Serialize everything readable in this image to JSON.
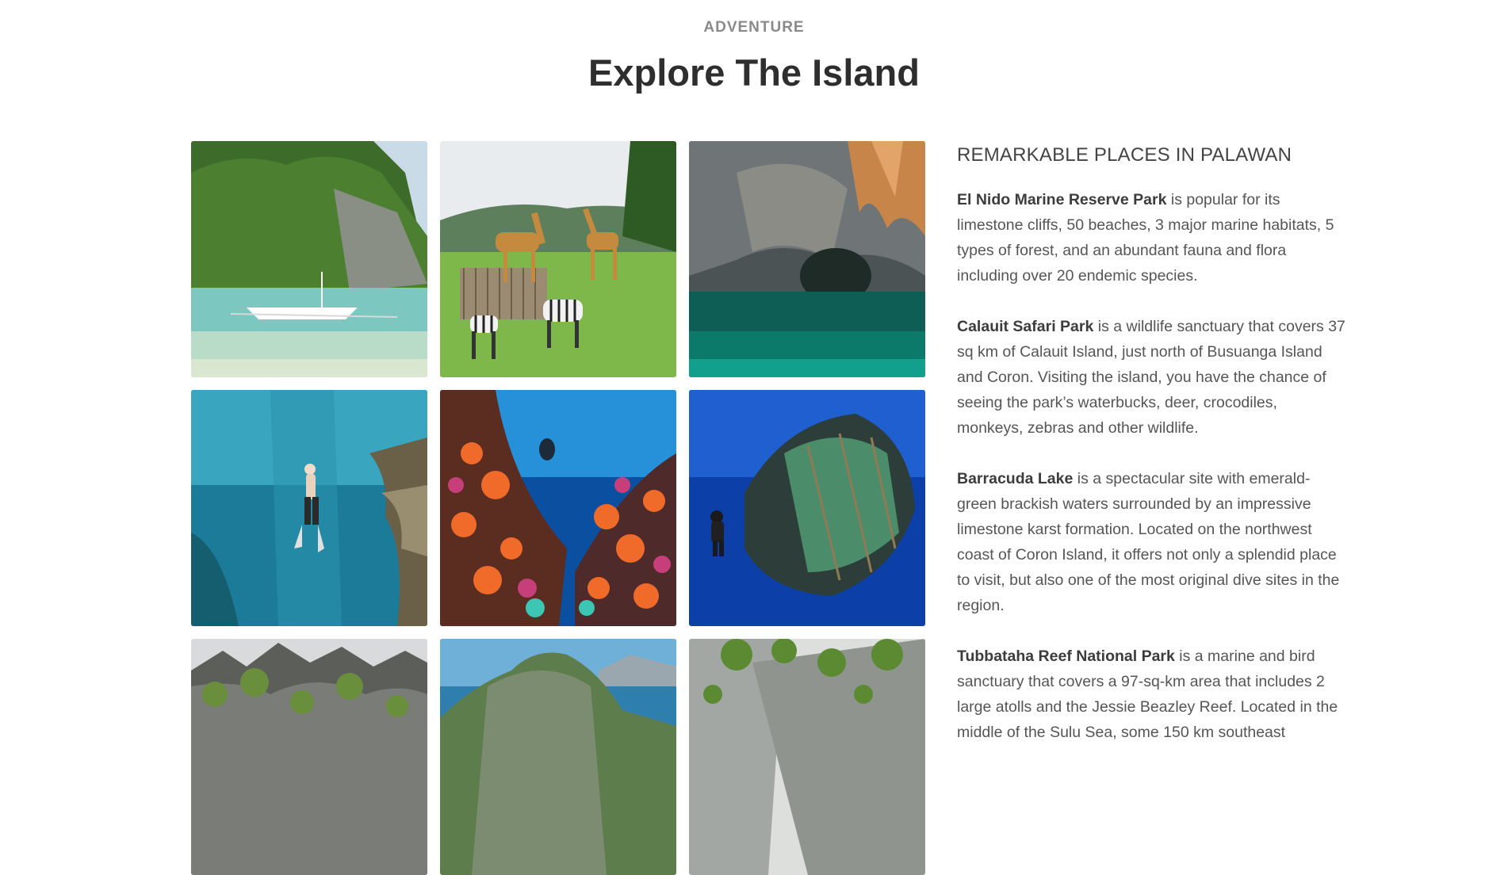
{
  "section": {
    "eyebrow": "ADVENTURE",
    "title": "Explore The Island"
  },
  "gallery": {
    "images": [
      {
        "subject": "Limestone cliff island with outrigger boat on turquoise water"
      },
      {
        "subject": "Giraffes and zebras grazing at safari park"
      },
      {
        "subject": "Underground river cave with emerald water"
      },
      {
        "subject": "Freediver descending in blue lagoon by rock wall"
      },
      {
        "subject": "Colorful coral reef with scuba diver"
      },
      {
        "subject": "Scuba diver exploring shipwreck"
      },
      {
        "subject": "Jagged limestone karst hills with greenery"
      },
      {
        "subject": "Green karst island over lagoon with blue sky"
      },
      {
        "subject": "Limestone cliff wall with hanging vegetation"
      }
    ]
  },
  "sidebar": {
    "heading": "REMARKABLE PLACES IN PALAWAN",
    "places": [
      {
        "name": "El Nido Marine Reserve Park",
        "description": " is popular for its limestone cliffs, 50 beaches, 3 major marine habitats, 5 types of forest, and an abundant fauna and flora including over 20 endemic species."
      },
      {
        "name": "Calauit Safari Park",
        "description": " is a wildlife sanctuary that covers 37 sq km of Calauit Island, just north of Busuanga Island and Coron. Visiting the island, you have the chance of seeing the park’s waterbucks, deer, crocodiles, monkeys, zebras and other wildlife."
      },
      {
        "name": "Barracuda Lake",
        "description": " is a spectacular site with emerald-green brackish waters surrounded by an impressive limestone karst formation. Located on the northwest coast of Coron Island, it offers not only a splendid place to visit, but also one of the most original dive sites in the region."
      },
      {
        "name": "Tubbataha Reef National Park",
        "description": " is a marine and bird sanctuary that covers a 97-sq-km area that includes 2 large atolls and the Jessie Beazley Reef. Located in the middle of the Sulu Sea, some 150 km southeast"
      }
    ]
  }
}
